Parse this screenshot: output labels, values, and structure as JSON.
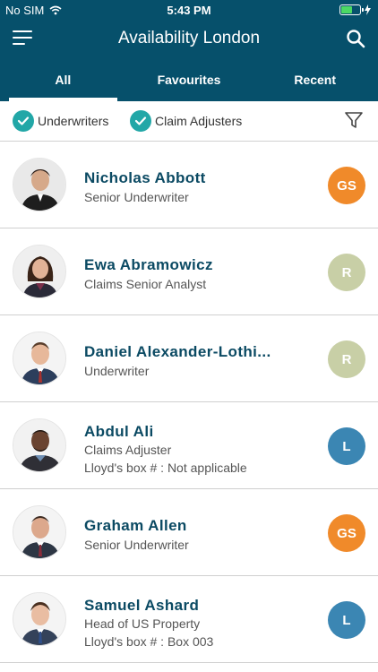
{
  "status": {
    "carrier": "No SIM",
    "time": "5:43 PM",
    "battery_level": 0.6
  },
  "header": {
    "title": "Availability London"
  },
  "tabs": [
    {
      "label": "All",
      "active": true
    },
    {
      "label": "Favourites",
      "active": false
    },
    {
      "label": "Recent",
      "active": false
    }
  ],
  "filters": [
    {
      "label": "Underwriters",
      "checked": true
    },
    {
      "label": "Claim Adjusters",
      "checked": true
    }
  ],
  "colors": {
    "header": "#06506b",
    "teal_check": "#22a7a7",
    "badge_gs": "#f08a2a",
    "badge_r": "#c8cfa6",
    "badge_l": "#3b86b3"
  },
  "people": [
    {
      "name": "Nicholas Abbott",
      "role": "Senior Underwriter",
      "lloyds": "",
      "badge": "GS",
      "badge_color": "#f08a2a"
    },
    {
      "name": "Ewa Abramowicz",
      "role": "Claims Senior Analyst",
      "lloyds": "",
      "badge": "R",
      "badge_color": "#c8cfa6"
    },
    {
      "name": "Daniel Alexander-Lothi...",
      "role": "Underwriter",
      "lloyds": "",
      "badge": "R",
      "badge_color": "#c8cfa6"
    },
    {
      "name": "Abdul Ali",
      "role": "Claims Adjuster",
      "lloyds": "Lloyd's box # : Not applicable",
      "badge": "L",
      "badge_color": "#3b86b3"
    },
    {
      "name": "Graham Allen",
      "role": "Senior Underwriter",
      "lloyds": "",
      "badge": "GS",
      "badge_color": "#f08a2a"
    },
    {
      "name": "Samuel Ashard",
      "role": "Head of US Property",
      "lloyds": "Lloyd's box # : Box 003",
      "badge": "L",
      "badge_color": "#3b86b3"
    }
  ]
}
